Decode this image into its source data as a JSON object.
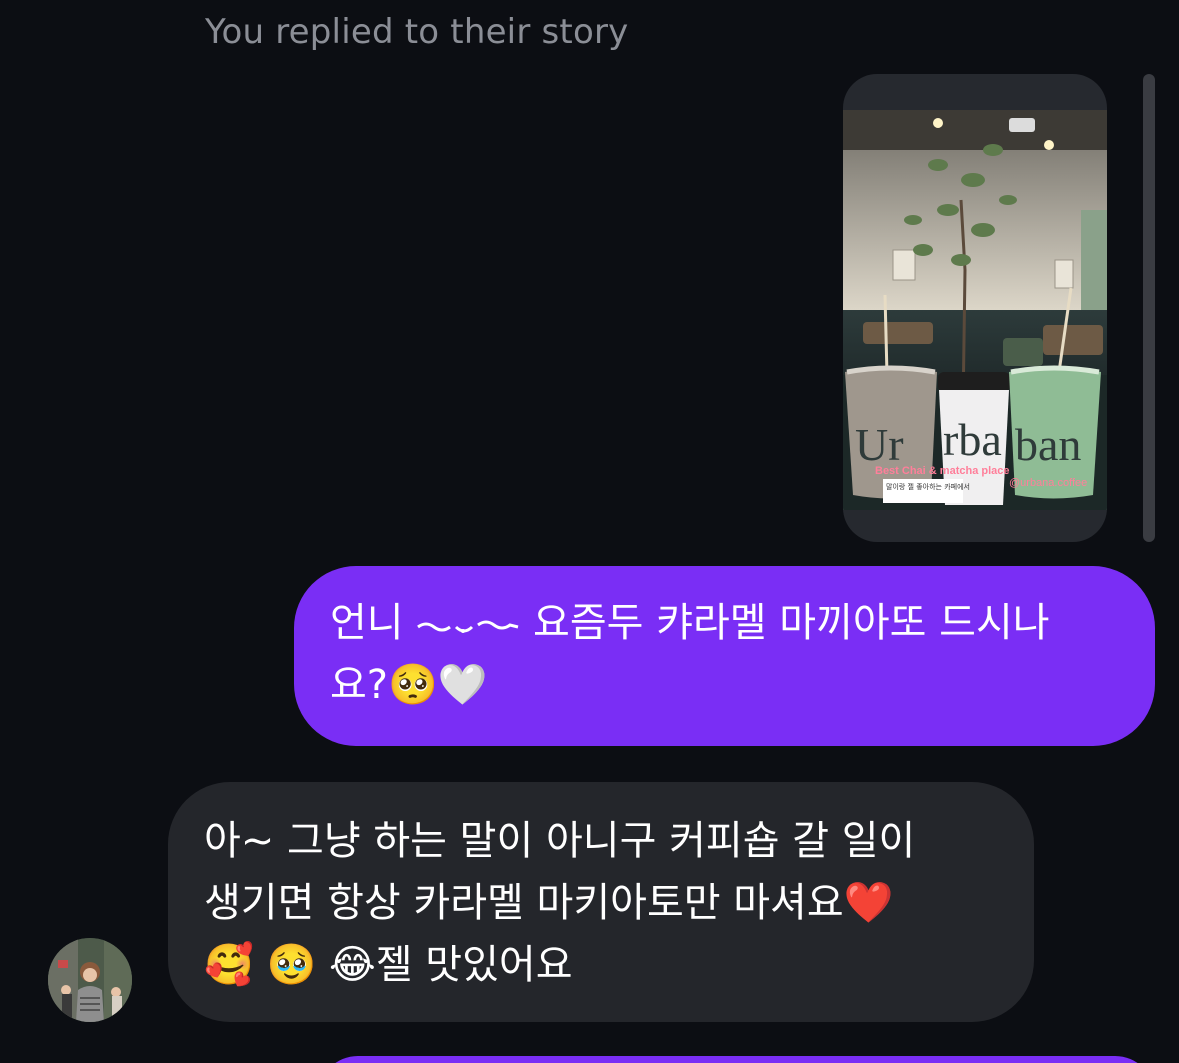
{
  "thread": {
    "system_note": "You replied to their story"
  },
  "story_reply": {
    "cup_texts": [
      "Ur",
      "rba",
      "ban"
    ],
    "caption_main": "Best Chai & matcha place",
    "caption_sub": "말이랑 젤 좋아하는 카페에서",
    "mention": "@urbana.coffee"
  },
  "messages": [
    {
      "direction": "outgoing",
      "text_before_scribble": "언니 ",
      "text_after_scribble": " 요즘두 캬라멜 마끼아또 드시나",
      "text_line2": "요?🥺🤍"
    },
    {
      "direction": "incoming",
      "line1": "아~ 그냥 하는 말이 아니구 커피숍 갈 일이",
      "line2": "생기면 항상 카라멜 마키아토만 마셔요❤️",
      "line3": "🥰 🥹 😂젤 맛있어요"
    }
  ],
  "colors": {
    "background": "#0c0e13",
    "outgoing_bubble": "#7a2ef5",
    "incoming_bubble": "#24262b",
    "system_text": "#8b8e96"
  }
}
